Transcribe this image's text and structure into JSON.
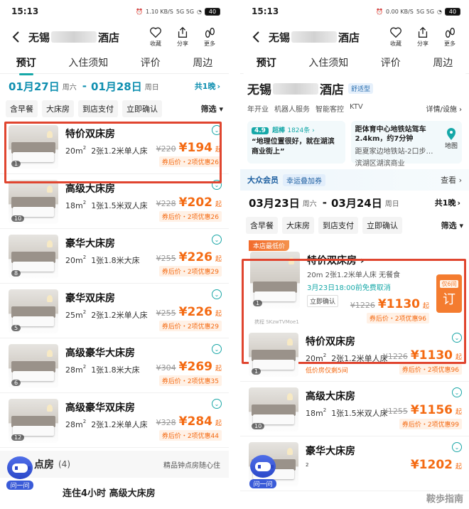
{
  "left": {
    "status": {
      "time": "15:13",
      "battery": "40",
      "net": "1.10 KB/S",
      "signal": "5G 5G"
    },
    "header": {
      "city": "无锡",
      "suffix": "酒店",
      "actions": [
        {
          "label": "收藏"
        },
        {
          "label": "分享"
        },
        {
          "label": "更多"
        }
      ]
    },
    "tabs": [
      "预订",
      "入住须知",
      "评价",
      "周边"
    ],
    "dates": {
      "checkin": "01月27日",
      "checkin_wk": "周六",
      "checkout": "01月28日",
      "checkout_wk": "周日",
      "nights": "共1晚"
    },
    "filters": [
      "含早餐",
      "大床房",
      "到店支付",
      "立即确认"
    ],
    "filter_btn": "筛选",
    "rooms": [
      {
        "name": "特价双床房",
        "area": "20m",
        "bed": "2张1.2米单人床",
        "old": "¥220",
        "price": "¥194",
        "qi": "起",
        "coupon": "券后价・2项优惠26",
        "photos": "1"
      },
      {
        "name": "高级大床房",
        "area": "18m",
        "bed": "1张1.5米双人床",
        "old": "¥228",
        "price": "¥202",
        "qi": "起",
        "coupon": "券后价・2项优惠26",
        "photos": "10"
      },
      {
        "name": "豪华大床房",
        "area": "20m",
        "bed": "1张1.8米大床",
        "old": "¥255",
        "price": "¥226",
        "qi": "起",
        "coupon": "券后价・2项优惠29",
        "photos": "8"
      },
      {
        "name": "豪华双床房",
        "area": "25m",
        "bed": "2张1.2米单人床",
        "old": "¥255",
        "price": "¥226",
        "qi": "起",
        "coupon": "券后价・2项优惠29",
        "photos": "5"
      },
      {
        "name": "高级豪华大床房",
        "area": "28m",
        "bed": "1张1.8米大床",
        "old": "¥304",
        "price": "¥269",
        "qi": "起",
        "coupon": "券后价・2项优惠35",
        "photos": "6"
      },
      {
        "name": "高级豪华双床房",
        "area": "28m",
        "bed": "2张1.2米单人床",
        "old": "¥328",
        "price": "¥284",
        "qi": "起",
        "coupon": "券后价・2项优惠44",
        "photos": "12"
      }
    ],
    "hourly": {
      "title": "点房",
      "count": "(4)",
      "note": "精品钟点房随心住"
    },
    "bot_label": "问一问",
    "partial": "连住4小时  高级大床房"
  },
  "right": {
    "status": {
      "time": "15:13",
      "battery": "40",
      "net": "0.00 KB/S",
      "signal": "5G 5G"
    },
    "header": {
      "city": "无锡",
      "suffix": "酒店",
      "actions": [
        {
          "label": "收藏"
        },
        {
          "label": "分享"
        },
        {
          "label": "更多"
        }
      ]
    },
    "tabs": [
      "预订",
      "入住须知",
      "评价",
      "周边"
    ],
    "hotel": {
      "city": "无锡",
      "suffix": "酒店",
      "tag": "舒适型",
      "meta": [
        "年开业",
        "机器人服务",
        "智能客控",
        "KTV"
      ],
      "detail": "详情/设施 ›"
    },
    "review": {
      "score": "4.9",
      "word": "超棒",
      "count": "1824条 ›",
      "quote": "“地理位置很好，就在湖滨商业街上”"
    },
    "location": {
      "line1": "距体育中心地铁站驾车2.4km，约7分钟",
      "line2": "距夏家边地铁站-2口步…",
      "line3": "滨湖区湖滨商业",
      "map": "地图"
    },
    "member": {
      "name": "大众会员",
      "tag": "幸运叠加券",
      "look": "查看 ›"
    },
    "dates": {
      "checkin": "03月23日",
      "checkin_wk": "周六",
      "checkout": "03月24日",
      "checkout_wk": "周日",
      "nights": "共1晚"
    },
    "filters": [
      "含早餐",
      "大床房",
      "到店支付",
      "立即确认"
    ],
    "filter_btn": "筛选",
    "featured": {
      "badge": "本店最低价",
      "name": "特价双床房 ›",
      "spec": "20m  2张1.2米单人床  无餐食",
      "cancel": "3月23日18:00前免费取消",
      "confirm": "立即确认",
      "old": "¥1226",
      "price": "¥1130",
      "qi": "起",
      "coupon": "券后价・2项优惠96",
      "book_tag": "仅6间",
      "book": "订",
      "wm": "携程 SKzwTVMoe1",
      "photos": "1"
    },
    "rooms": [
      {
        "name": "特价双床房",
        "area": "20m",
        "bed": "2张1.2米单人床",
        "old": "¥1226",
        "price": "¥1130",
        "qi": "起",
        "coupon": "券后价・2项优惠96",
        "hint": "低价房仅剩5间",
        "photos": "1"
      },
      {
        "name": "高级大床房",
        "area": "18m",
        "bed": "1张1.5米双人床",
        "old": "¥1255",
        "price": "¥1156",
        "qi": "起",
        "coupon": "券后价・2项优惠99",
        "photos": "10"
      },
      {
        "name": "豪华大床房",
        "area": "",
        "bed": "",
        "old": "",
        "price": "¥1202",
        "qi": "起",
        "coupon": "",
        "photos": ""
      }
    ],
    "bot_label": "问一问",
    "watermark": "鞍歩指南"
  }
}
